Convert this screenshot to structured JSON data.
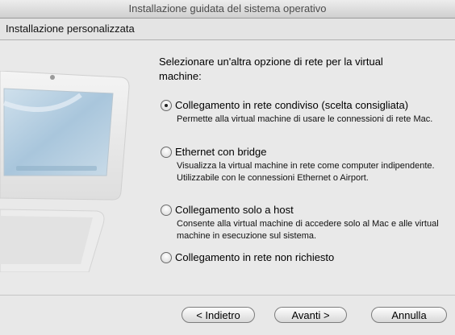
{
  "window": {
    "title": "Installazione guidata del sistema operativo"
  },
  "section": {
    "title": "Installazione personalizzata"
  },
  "prompt": "Selezionare un'altra opzione di rete per la virtual machine:",
  "options": [
    {
      "label": "Collegamento in rete condiviso (scelta consigliata)",
      "description": "Permette alla virtual machine di usare le connessioni di rete Mac.",
      "selected": true
    },
    {
      "label": "Ethernet con bridge",
      "description": "Visualizza la virtual machine in rete come computer indipendente. Utilizzabile con le connessioni Ethernet o Airport.",
      "selected": false
    },
    {
      "label": "Collegamento solo a host",
      "description": "Consente alla virtual machine di accedere solo al Mac e alle virtual machine in esecuzione sul sistema.",
      "selected": false
    },
    {
      "label": "Collegamento in rete non richiesto",
      "description": "",
      "selected": false
    }
  ],
  "buttons": {
    "back": "< Indietro",
    "next": "Avanti >",
    "cancel": "Annulla"
  },
  "illustration": {
    "icon": "imac-computer-icon"
  }
}
